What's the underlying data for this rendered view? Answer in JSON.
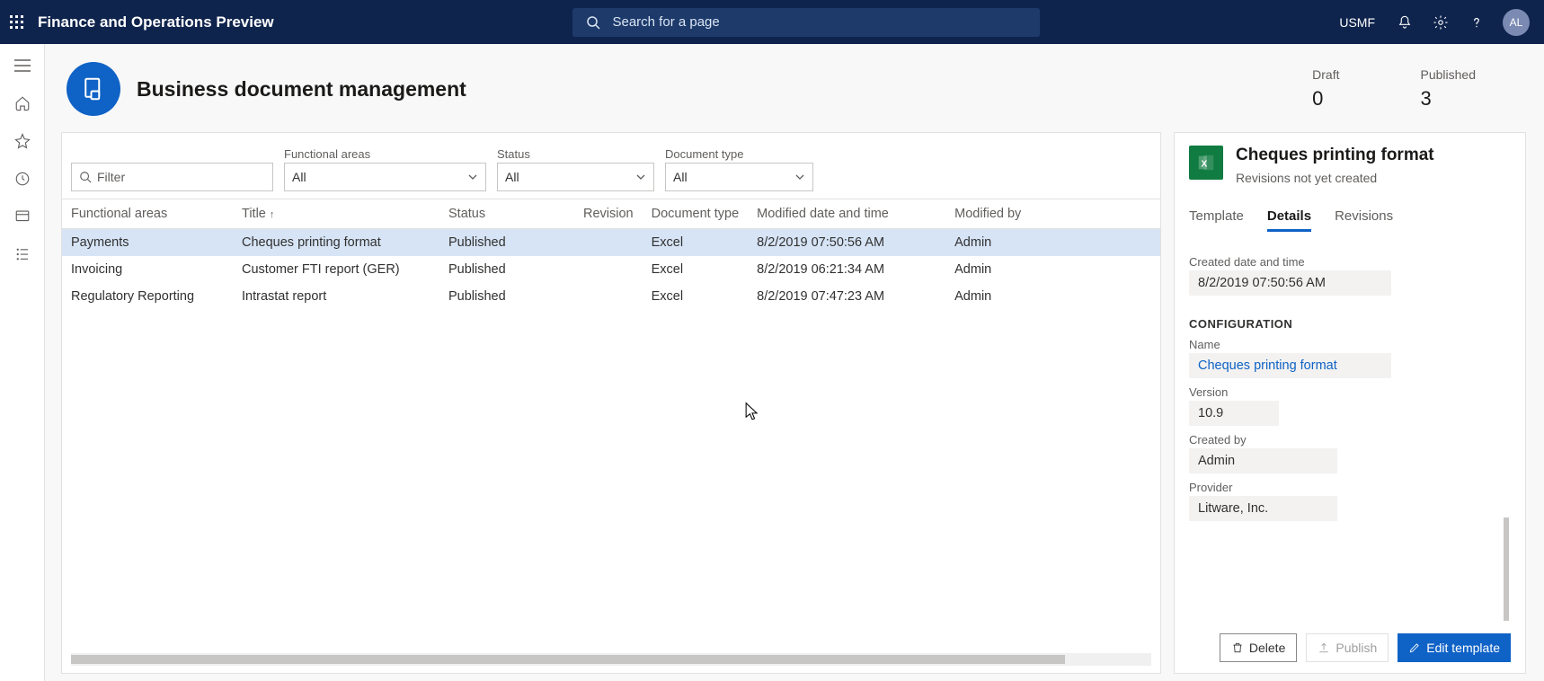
{
  "header": {
    "app_title": "Finance and Operations Preview",
    "search_placeholder": "Search for a page",
    "company": "USMF",
    "avatar_initials": "AL"
  },
  "page": {
    "title": "Business document management",
    "stats": {
      "draft_label": "Draft",
      "draft_value": "0",
      "published_label": "Published",
      "published_value": "3"
    }
  },
  "filters": {
    "filter_placeholder": "Filter",
    "functional_areas": {
      "label": "Functional areas",
      "value": "All"
    },
    "status": {
      "label": "Status",
      "value": "All"
    },
    "document_type": {
      "label": "Document type",
      "value": "All"
    }
  },
  "columns": {
    "functional_areas": "Functional areas",
    "title": "Title",
    "status": "Status",
    "revision": "Revision",
    "document_type": "Document type",
    "modified_date": "Modified date and time",
    "modified_by": "Modified by"
  },
  "rows": [
    {
      "fa": "Payments",
      "title": "Cheques printing format",
      "status": "Published",
      "rev": "",
      "dtype": "Excel",
      "mdate": "8/2/2019 07:50:56 AM",
      "mby": "Admin",
      "selected": true
    },
    {
      "fa": "Invoicing",
      "title": "Customer FTI report (GER)",
      "status": "Published",
      "rev": "",
      "dtype": "Excel",
      "mdate": "8/2/2019 06:21:34 AM",
      "mby": "Admin",
      "selected": false
    },
    {
      "fa": "Regulatory Reporting",
      "title": "Intrastat report",
      "status": "Published",
      "rev": "",
      "dtype": "Excel",
      "mdate": "8/2/2019 07:47:23 AM",
      "mby": "Admin",
      "selected": false
    }
  ],
  "detail": {
    "title": "Cheques printing format",
    "subtitle": "Revisions not yet created",
    "tabs": {
      "template": "Template",
      "details": "Details",
      "revisions": "Revisions"
    },
    "created_label": "Created date and time",
    "created_value": "8/2/2019 07:50:56 AM",
    "config_header": "CONFIGURATION",
    "name_label": "Name",
    "name_value": "Cheques printing format",
    "version_label": "Version",
    "version_value": "10.9",
    "createdby_label": "Created by",
    "createdby_value": "Admin",
    "provider_label": "Provider",
    "provider_value": "Litware, Inc.",
    "actions": {
      "delete": "Delete",
      "publish": "Publish",
      "edit": "Edit template"
    }
  }
}
